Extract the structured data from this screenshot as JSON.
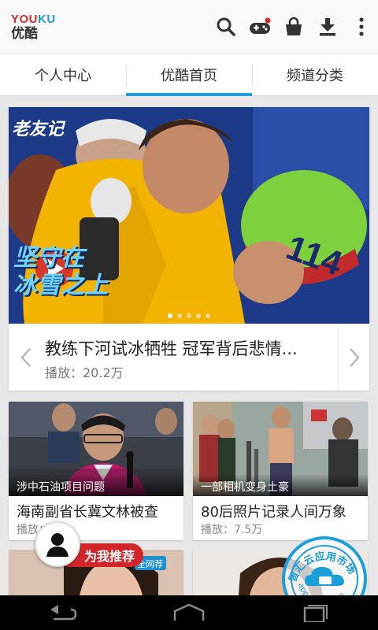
{
  "app": {
    "logo_en_a": "YOU",
    "logo_en_b": "KU",
    "logo_cn": "优酷",
    "brand_red": "#d62a2a",
    "brand_blue": "#1a9fd9"
  },
  "header": {
    "actions": [
      "search-icon",
      "gamepad-icon",
      "shopping-bag-icon",
      "download-icon",
      "overflow-menu-icon"
    ]
  },
  "tabs": [
    {
      "label": "个人中心",
      "active": false
    },
    {
      "label": "优酷首页",
      "active": true
    },
    {
      "label": "频道分类",
      "active": false
    }
  ],
  "accent_color": "#1ca0db",
  "banner": {
    "watermark": "老友记",
    "overlay_line1": "坚守在",
    "overlay_line2": "冰雪之上",
    "helmet_number": "114",
    "title": "教练下河试冰牺牲 冠军背后悲情...",
    "plays": "播放：20.2万",
    "slide_count": 5,
    "active_slide": 1
  },
  "videos": [
    {
      "caption": "涉中石油项目问题",
      "title": "海南副省长冀文林被查",
      "plays": "播放："
    },
    {
      "caption": "一部相机变身土豪",
      "title": "80后照片记录人间万象",
      "plays": "播放：7.5万"
    },
    {
      "badge": "全网荐"
    }
  ],
  "recommend": {
    "label": "为我推荐"
  },
  "stamp": {
    "line1": "智汇云应用市场",
    "line2": "app.ymall.com"
  }
}
